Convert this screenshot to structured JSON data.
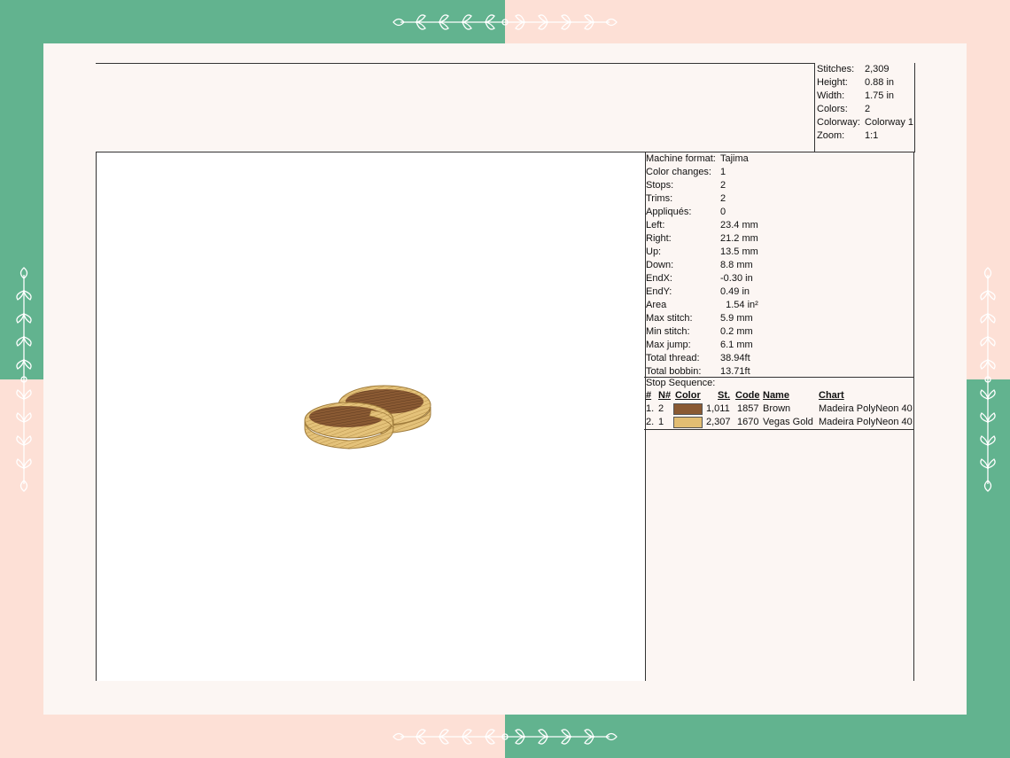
{
  "colors": {
    "green": "#62b38f",
    "pink": "#fde0d6",
    "frame": "#fcf6f3",
    "ring_brown": "#8a5a33",
    "ring_gold": "#e2bd72"
  },
  "summary": [
    {
      "label": "Stitches:",
      "value": "2,309"
    },
    {
      "label": "Height:",
      "value": "0.88 in"
    },
    {
      "label": "Width:",
      "value": "1.75 in"
    },
    {
      "label": "Colors:",
      "value": "2"
    },
    {
      "label": "Colorway:",
      "value": "Colorway 1"
    },
    {
      "label": "Zoom:",
      "value": "1:1"
    }
  ],
  "details": [
    {
      "label": "Machine format:",
      "value": "Tajima"
    },
    {
      "label": "Color changes:",
      "value": "1"
    },
    {
      "label": "Stops:",
      "value": "2"
    },
    {
      "label": "Trims:",
      "value": "2"
    },
    {
      "label": "Appliqués:",
      "value": "0"
    },
    {
      "label": "Left:",
      "value": "23.4 mm"
    },
    {
      "label": "Right:",
      "value": "21.2 mm"
    },
    {
      "label": "Up:",
      "value": "13.5 mm"
    },
    {
      "label": "Down:",
      "value": "8.8 mm"
    },
    {
      "label": "EndX:",
      "value": "-0.30 in"
    },
    {
      "label": "EndY:",
      "value": "0.49 in"
    },
    {
      "label": "Area",
      "value": "  1.54 in²"
    },
    {
      "label": "Max stitch:",
      "value": "5.9 mm"
    },
    {
      "label": "Min stitch:",
      "value": "0.2 mm"
    },
    {
      "label": "Max jump:",
      "value": "6.1 mm"
    },
    {
      "label": "Total thread:",
      "value": "38.94ft"
    },
    {
      "label": "Total bobbin:",
      "value": "13.71ft"
    }
  ],
  "stop_sequence": {
    "title": "Stop Sequence:",
    "headers": {
      "num": "#",
      "needle": "N#",
      "color": "Color",
      "stitches": "St.",
      "code": "Code",
      "name": "Name",
      "chart": "Chart"
    },
    "rows": [
      {
        "num": "1.",
        "needle": "2",
        "swatch": "#8a5a33",
        "stitches": "1,011",
        "code": "1857",
        "name": "Brown",
        "chart": "Madeira PolyNeon 40"
      },
      {
        "num": "2.",
        "needle": "1",
        "swatch": "#e2bd72",
        "stitches": "2,307",
        "code": "1670",
        "name": "Vegas Gold",
        "chart": "Madeira PolyNeon 40"
      }
    ]
  }
}
